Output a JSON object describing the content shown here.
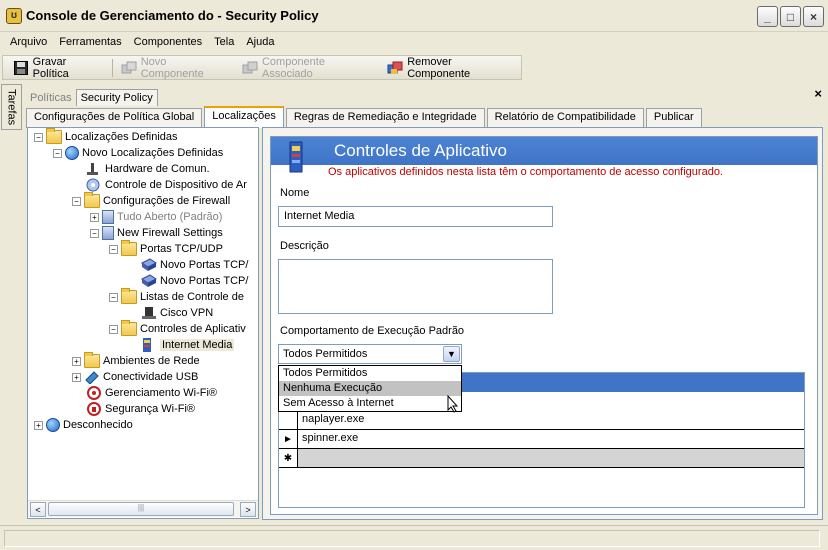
{
  "window": {
    "title": "Console de Gerenciamento do - Security Policy",
    "controls": [
      "_",
      "□",
      "×"
    ]
  },
  "menu": [
    "Arquivo",
    "Ferramentas",
    "Componentes",
    "Tela",
    "Ajuda"
  ],
  "toolbar": {
    "save": "Gravar Política",
    "new_component": "Novo Componente",
    "assoc_component": "Componente Associado",
    "remove_component": "Remover Componente"
  },
  "taskstrip": "Tarefas",
  "doc_tabs": [
    "Políticas",
    "Security Policy"
  ],
  "close_label": "×",
  "main_tabs": [
    "Configurações de Política Global",
    "Localizações",
    "Regras de Remediação e Integridade",
    "Relatório de Compatibilidade",
    "Publicar"
  ],
  "tree": [
    {
      "label": "Localizações Definidas",
      "expander": "−",
      "icon": "folder"
    },
    {
      "label": "Novo Localizações Definidas",
      "expander": "−",
      "icon": "globe"
    },
    {
      "label": "Hardware de Comun.",
      "icon": "modem"
    },
    {
      "label": "Controle de Dispositivo de Ar",
      "icon": "device"
    },
    {
      "label": "Configurações de Firewall",
      "expander": "−",
      "icon": "folder"
    },
    {
      "label": "Tudo Aberto (Padrão)",
      "expander": "+",
      "icon": "firewall",
      "grey": true
    },
    {
      "label": "New Firewall Settings",
      "expander": "−",
      "icon": "firewall"
    },
    {
      "label": "Portas TCP/UDP",
      "expander": "−",
      "icon": "folder"
    },
    {
      "label": "Novo Portas TCP/",
      "icon": "ports"
    },
    {
      "label": "Novo Portas TCP/",
      "icon": "ports"
    },
    {
      "label": "Listas de Controle de",
      "expander": "−",
      "icon": "folder"
    },
    {
      "label": "Cisco VPN",
      "icon": "vpn"
    },
    {
      "label": "Controles de Aplicativ",
      "expander": "−",
      "icon": "folder"
    },
    {
      "label": "Internet Media",
      "icon": "app",
      "selected": true
    },
    {
      "label": "Ambientes de Rede",
      "expander": "+",
      "icon": "folder"
    },
    {
      "label": "Conectividade USB",
      "expander": "+",
      "icon": "usb"
    },
    {
      "label": "Gerenciamento Wi-Fi®",
      "icon": "wifi"
    },
    {
      "label": "Segurança Wi-Fi®",
      "icon": "wifi"
    },
    {
      "label": "Desconhecido",
      "expander": "+",
      "icon": "globe"
    }
  ],
  "scroll": {
    "left": "<",
    "right": ">",
    "grip": "|||"
  },
  "panel": {
    "title": "Controles de Aplicativo",
    "subtitle": "Os aplicativos definidos nesta lista têm o comportamento de acesso configurado.",
    "name_label": "Nome",
    "name_value": "Internet Media",
    "desc_label": "Descrição",
    "desc_value": "",
    "behavior_label": "Comportamento de Execução Padrão",
    "behavior_value": "Todos Permitidos",
    "options": [
      "Todos Permitidos",
      "Nenhuma Execução",
      "Sem Acesso à Internet"
    ],
    "hovered_option": "Nenhuma Execução"
  },
  "grid": {
    "rows": [
      {
        "marker": "",
        "value": "naplayer.exe"
      },
      {
        "marker": "►",
        "value": "spinner.exe"
      },
      {
        "marker": "✱",
        "value": ""
      }
    ]
  }
}
